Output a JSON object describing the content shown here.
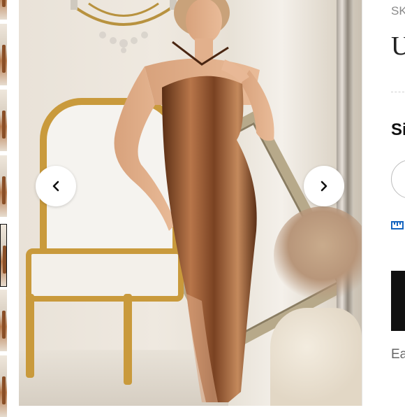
{
  "gallery": {
    "thumbnail_count": 6,
    "active_thumbnail": 4,
    "prev_icon": "chevron-left-icon",
    "next_icon": "chevron-right-icon"
  },
  "product": {
    "sku_text": "SK",
    "title_text": "U",
    "size_label": "Si",
    "footer_text": "Ea"
  },
  "colors": {
    "accent": "#1565c0",
    "button": "#111111",
    "dress": "#8a4f27"
  }
}
